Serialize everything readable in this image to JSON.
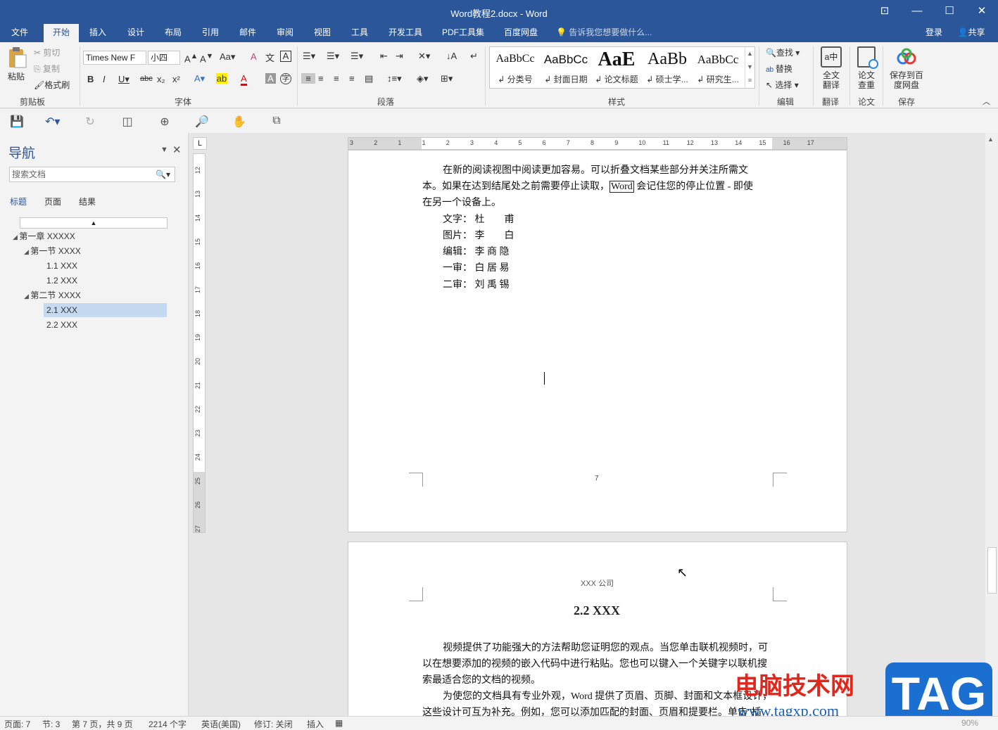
{
  "window": {
    "title": "Word教程2.docx - Word",
    "controls": {
      "ribbon_display": "⊡",
      "minimize": "—",
      "maximize": "☐",
      "close": "✕"
    }
  },
  "tabs": [
    {
      "label": "文件"
    },
    {
      "label": "开始"
    },
    {
      "label": "插入"
    },
    {
      "label": "设计"
    },
    {
      "label": "布局"
    },
    {
      "label": "引用"
    },
    {
      "label": "邮件"
    },
    {
      "label": "审阅"
    },
    {
      "label": "视图"
    },
    {
      "label": "工具"
    },
    {
      "label": "开发工具"
    },
    {
      "label": "PDF工具集"
    },
    {
      "label": "百度网盘"
    }
  ],
  "tellme": {
    "placeholder": "告诉我您想要做什么..."
  },
  "account": {
    "login": "登录",
    "share": "共享"
  },
  "ribbon": {
    "clipboard": {
      "paste": "粘贴",
      "cut": "剪切",
      "copy": "复制",
      "format_painter": "格式刷",
      "label": "剪贴板"
    },
    "font": {
      "name": "Times New F",
      "size": "小四",
      "change_case": "Aa",
      "label": "字体"
    },
    "paragraph": {
      "label": "段落"
    },
    "styles": {
      "label": "样式",
      "items": [
        {
          "preview": "AaBbCc",
          "name": "↲ 分类号"
        },
        {
          "preview": "AaBbCc",
          "name": "↲ 封面日期"
        },
        {
          "preview": "AaE",
          "name": "↲ 论文标题"
        },
        {
          "preview": "AaBb",
          "name": "↲ 硕士学..."
        },
        {
          "preview": "AaBbCc",
          "name": "↲ 研究生..."
        }
      ]
    },
    "editing": {
      "find": "查找",
      "replace": "替换",
      "select": "选择",
      "label": "编辑"
    },
    "translate": {
      "full": "全文翻译",
      "label": "翻译"
    },
    "paper": {
      "check": "论文查重",
      "label": "论文"
    },
    "save": {
      "baidu": "保存到百度网盘",
      "label": "保存"
    }
  },
  "nav": {
    "title": "导航",
    "search_placeholder": "搜索文档",
    "tabs": [
      "标题",
      "页面",
      "结果"
    ],
    "tree": [
      {
        "label": "第一章 XXXXX",
        "level": 0,
        "selected": false
      },
      {
        "label": "第一节 XXXX",
        "level": 1,
        "selected": false
      },
      {
        "label": "1.1 XXX",
        "level": 2,
        "selected": false
      },
      {
        "label": "1.2 XXX",
        "level": 2,
        "selected": false
      },
      {
        "label": "第二节 XXXX",
        "level": 1,
        "selected": false
      },
      {
        "label": "2.1 XXX",
        "level": 2,
        "selected": true
      },
      {
        "label": "2.2 XXX",
        "level": 2,
        "selected": false
      }
    ]
  },
  "rulers": {
    "h_ticks": [
      "3",
      "2",
      "1",
      "1",
      "2",
      "3",
      "4",
      "5",
      "6",
      "7",
      "8",
      "9",
      "10",
      "11",
      "12",
      "13",
      "14",
      "15",
      "16",
      "17"
    ],
    "v_ticks": [
      "12",
      "13",
      "14",
      "15",
      "16",
      "17",
      "18",
      "19",
      "20",
      "21",
      "22",
      "23",
      "24",
      "25",
      "26",
      "27"
    ]
  },
  "page1": {
    "lines": [
      "在新的阅读视图中阅读更加容易。可以折叠文档某些部分并关注所需文",
      "本。如果在达到结尾处之前需要停止读取，",
      "Word",
      "会记住您的停止位置 - 即使",
      "在另一个设备上。"
    ],
    "credits": [
      {
        "role": "文字：",
        "name": "杜　　甫"
      },
      {
        "role": "图片：",
        "name": "李　　白"
      },
      {
        "role": "编辑：",
        "name": "李 商 隐"
      },
      {
        "role": "一审：",
        "name": "白 居 易"
      },
      {
        "role": "二审：",
        "name": "刘 禹 锡"
      }
    ],
    "page_number": "7"
  },
  "page2": {
    "header": "XXX 公司",
    "heading": "2.2 XXX",
    "lines": [
      "视频提供了功能强大的方法帮助您证明您的观点。当您单击联机视频时，可",
      "以在想要添加的视频的嵌入代码中进行粘贴。您也可以键入一个关键字以联机搜",
      "索最适合您的文档的视频。",
      "为使您的文档具有专业外观，Word 提供了页眉、页脚、封面和文本框设计，",
      "这些设计可互为补充。例如，您可以添加匹配的封面、页眉和提要栏。单击\"插"
    ]
  },
  "status": {
    "page": "页面: 7",
    "section": "节: 3",
    "page_of": "第 7 页，共 9 页",
    "words": "2214 个字",
    "language": "英语(美国)",
    "track": "修订: 关闭",
    "mode": "插入",
    "zoom": "90%"
  },
  "watermark": {
    "text": "电脑技术网",
    "url": "www.tagxp.com",
    "tag": "TAG"
  },
  "colors": {
    "word_blue": "#2b579a",
    "nav_selected": "#c5d9f1",
    "watermark_red": "#e1261c"
  }
}
